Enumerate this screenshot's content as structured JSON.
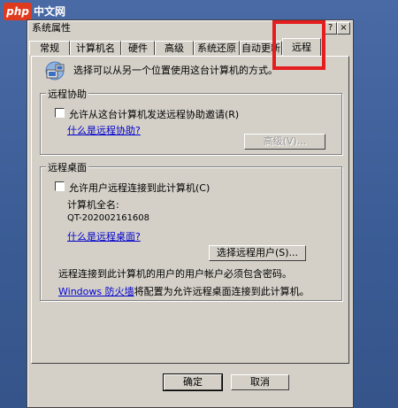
{
  "watermark": {
    "php": "php",
    "site": "中文网"
  },
  "dialog": {
    "title": "系统属性",
    "help_glyph": "?",
    "close_glyph": "×",
    "tabs": [
      {
        "label": "常规"
      },
      {
        "label": "计算机名"
      },
      {
        "label": "硬件"
      },
      {
        "label": "高级"
      },
      {
        "label": "系统还原"
      },
      {
        "label": "自动更新"
      },
      {
        "label": "远程",
        "active": true
      }
    ],
    "intro_text": "选择可以从另一个位置使用这台计算机的方式。",
    "remote_assistance": {
      "group_label": "远程协助",
      "checkbox_label": "允许从这台计算机发送远程协助邀请(R)",
      "link": "什么是远程协助?",
      "advanced_button": "高级(V)..."
    },
    "remote_desktop": {
      "group_label": "远程桌面",
      "checkbox_label": "允许用户远程连接到此计算机(C)",
      "full_name_label": "计算机全名:",
      "computer_name": "QT-202002161608",
      "link": "什么是远程桌面?",
      "select_users_button": "选择远程用户(S)...",
      "password_note": "远程连接到此计算机的用户的用户帐户必须包含密码。",
      "firewall_link": "Windows 防火墙",
      "firewall_note": "将配置为允许远程桌面连接到此计算机。"
    },
    "buttons": {
      "ok": "确定",
      "cancel": "取消"
    }
  }
}
